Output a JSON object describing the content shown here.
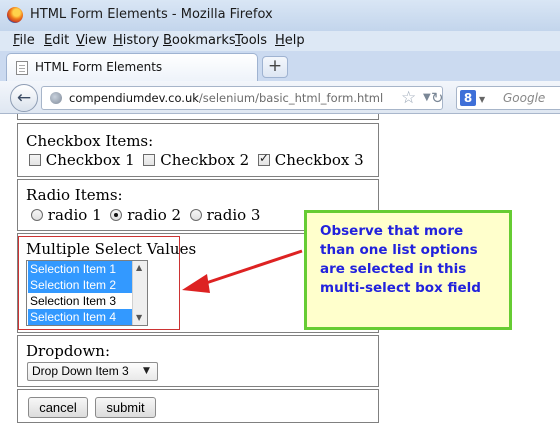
{
  "window": {
    "title": "HTML Form Elements - Mozilla Firefox"
  },
  "menu": [
    "File",
    "Edit",
    "View",
    "History",
    "Bookmarks",
    "Tools",
    "Help"
  ],
  "tab": {
    "label": "HTML Form Elements",
    "new_tab": "+"
  },
  "nav": {
    "back": "←",
    "url_host": "compendiumdev.co.uk",
    "url_path": "/selenium/basic_html_form.html",
    "search_engine_letter": "8",
    "search_placeholder": "Google"
  },
  "form": {
    "checkbox_section": {
      "label": "Checkbox Items:",
      "items": [
        {
          "label": "Checkbox 1",
          "checked": false
        },
        {
          "label": "Checkbox 2",
          "checked": false
        },
        {
          "label": "Checkbox 3",
          "checked": true
        }
      ]
    },
    "radio_section": {
      "label": "Radio Items:",
      "items": [
        {
          "label": "radio 1",
          "checked": false
        },
        {
          "label": "radio 2",
          "checked": true
        },
        {
          "label": "radio 3",
          "checked": false
        }
      ]
    },
    "multiselect_section": {
      "label": "Multiple Select Values",
      "options": [
        {
          "label": "Selection Item 1",
          "selected": true
        },
        {
          "label": "Selection Item 2",
          "selected": true
        },
        {
          "label": "Selection Item 3",
          "selected": false
        },
        {
          "label": "Selection Item 4",
          "selected": true
        }
      ]
    },
    "dropdown_section": {
      "label": "Dropdown:",
      "selected": "Drop Down Item 3"
    },
    "buttons": {
      "cancel": "cancel",
      "submit": "submit"
    }
  },
  "annotation": {
    "text": "Observe that more than one list options are selected in this multi-select box field",
    "text_color": "#2222dd",
    "bg_color": "#ffffcc",
    "border_color": "#66cc33",
    "arrow_color": "#dd2222"
  },
  "colors": {
    "selection_highlight": "#3399ff"
  }
}
